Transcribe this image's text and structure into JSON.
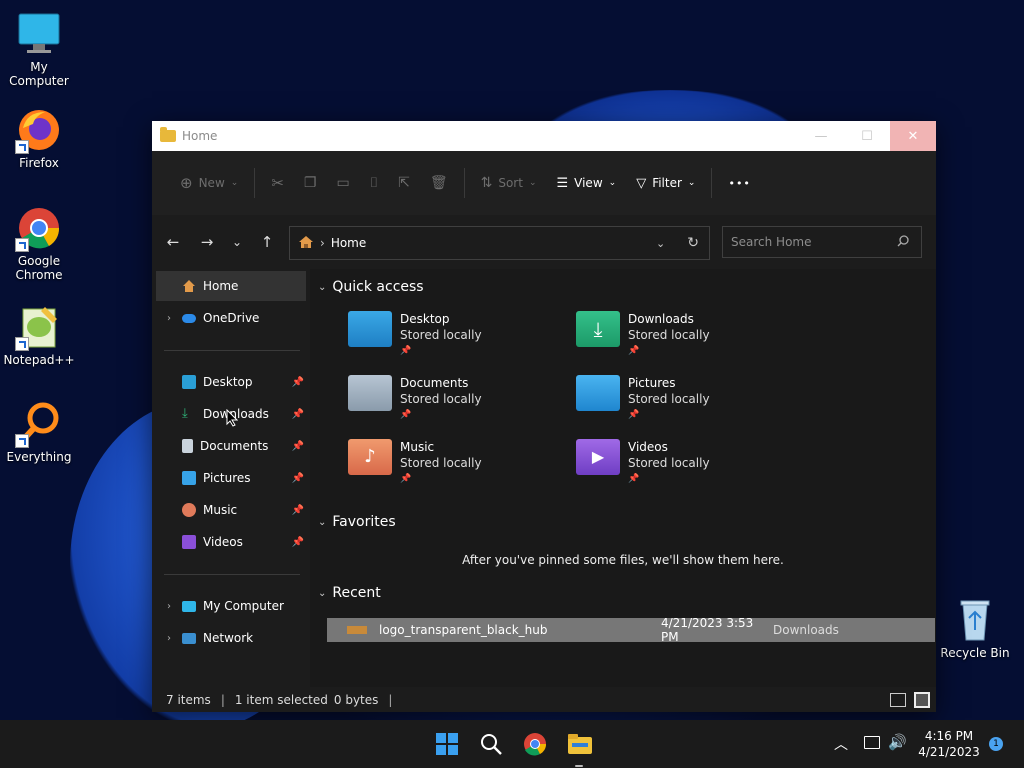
{
  "desktop": {
    "icons": [
      {
        "label": "My Computer"
      },
      {
        "label": "Firefox"
      },
      {
        "label": "Google Chrome"
      },
      {
        "label": "Notepad++"
      },
      {
        "label": "Everything"
      },
      {
        "label": "Recycle Bin"
      }
    ]
  },
  "window": {
    "title": "Home",
    "controls": {
      "minimize": "—",
      "maximize": "☐",
      "close": "✕"
    }
  },
  "toolbar": {
    "new_label": "New",
    "sort_label": "Sort",
    "view_label": "View",
    "filter_label": "Filter",
    "more_label": "•••"
  },
  "navigation": {
    "back": "←",
    "forward": "→",
    "recent": "⌄",
    "up": "↑",
    "address_separator": "›",
    "address": "Home",
    "search_placeholder": "Search Home"
  },
  "sidebar": {
    "items": [
      {
        "label": "Home"
      },
      {
        "label": "OneDrive"
      },
      {
        "label": "Desktop"
      },
      {
        "label": "Downloads"
      },
      {
        "label": "Documents"
      },
      {
        "label": "Pictures"
      },
      {
        "label": "Music"
      },
      {
        "label": "Videos"
      },
      {
        "label": "My Computer"
      },
      {
        "label": "Network"
      }
    ]
  },
  "quick_access": {
    "heading": "Quick access",
    "folders": [
      {
        "name": "Desktop",
        "status": "Stored locally"
      },
      {
        "name": "Downloads",
        "status": "Stored locally"
      },
      {
        "name": "Documents",
        "status": "Stored locally"
      },
      {
        "name": "Pictures",
        "status": "Stored locally"
      },
      {
        "name": "Music",
        "status": "Stored locally"
      },
      {
        "name": "Videos",
        "status": "Stored locally"
      }
    ]
  },
  "favorites": {
    "heading": "Favorites",
    "empty_message": "After you've pinned some files, we'll show them here."
  },
  "recent": {
    "heading": "Recent",
    "files": [
      {
        "name": "logo_transparent_black_hub",
        "date": "4/21/2023 3:53 PM",
        "location": "Downloads"
      }
    ]
  },
  "status_bar": {
    "items_count": "7 items",
    "selection": "1 item selected",
    "size": "0 bytes"
  },
  "taskbar": {
    "time": "4:16 PM",
    "date": "4/21/2023",
    "notification_count": "1"
  }
}
